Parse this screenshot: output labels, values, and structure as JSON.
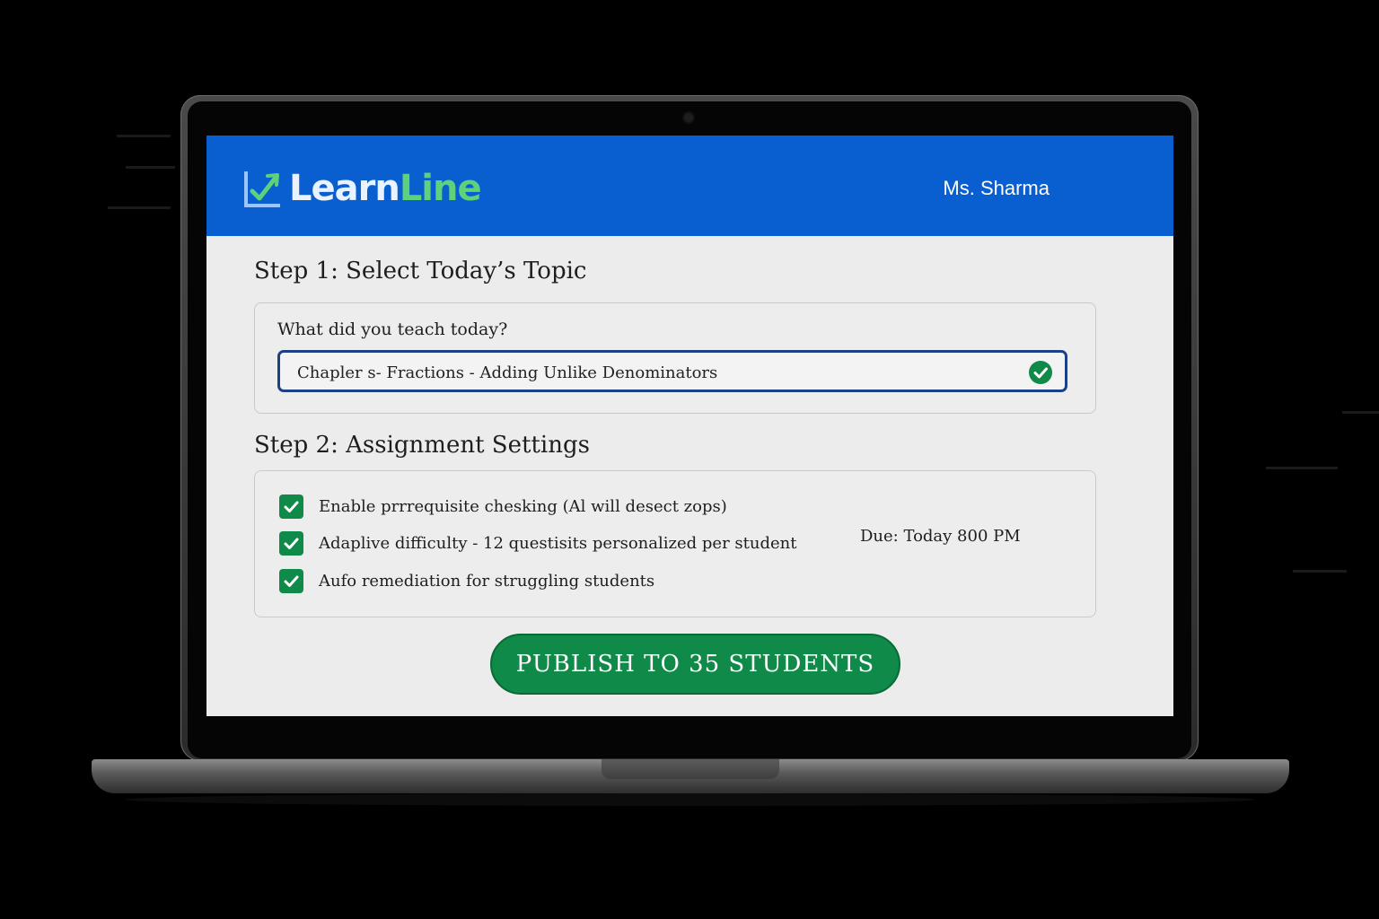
{
  "app": {
    "brand_part1": "Learn",
    "brand_part2": "Line",
    "brand_color_primary": "#0a5fd0",
    "brand_color_accent": "#5fd17a",
    "user_name": "Ms. Sharma",
    "logo_icon": "chart-arrow-check-icon"
  },
  "step1": {
    "title": "Step 1: Select Today’s Topic",
    "question": "What did you teach today?",
    "topic_value": "Chapler s- Fractions - Adding Unlike Denominators",
    "status_icon": "check-circle-icon"
  },
  "step2": {
    "title": "Step 2: Assignment Settings",
    "settings": [
      {
        "label": "Enable prrrequisite chesking (Al will desect zops)",
        "checked": true
      },
      {
        "label": "Adaplive difficulty - 12 questisits personalized per student",
        "checked": true
      },
      {
        "label": "Aufo remediation for struggling students",
        "checked": true
      }
    ],
    "due": "Due: Today 800 PM"
  },
  "actions": {
    "publish_label": "PUBLISH TO 35 STUDENTS",
    "publish_color": "#0f8a48"
  }
}
